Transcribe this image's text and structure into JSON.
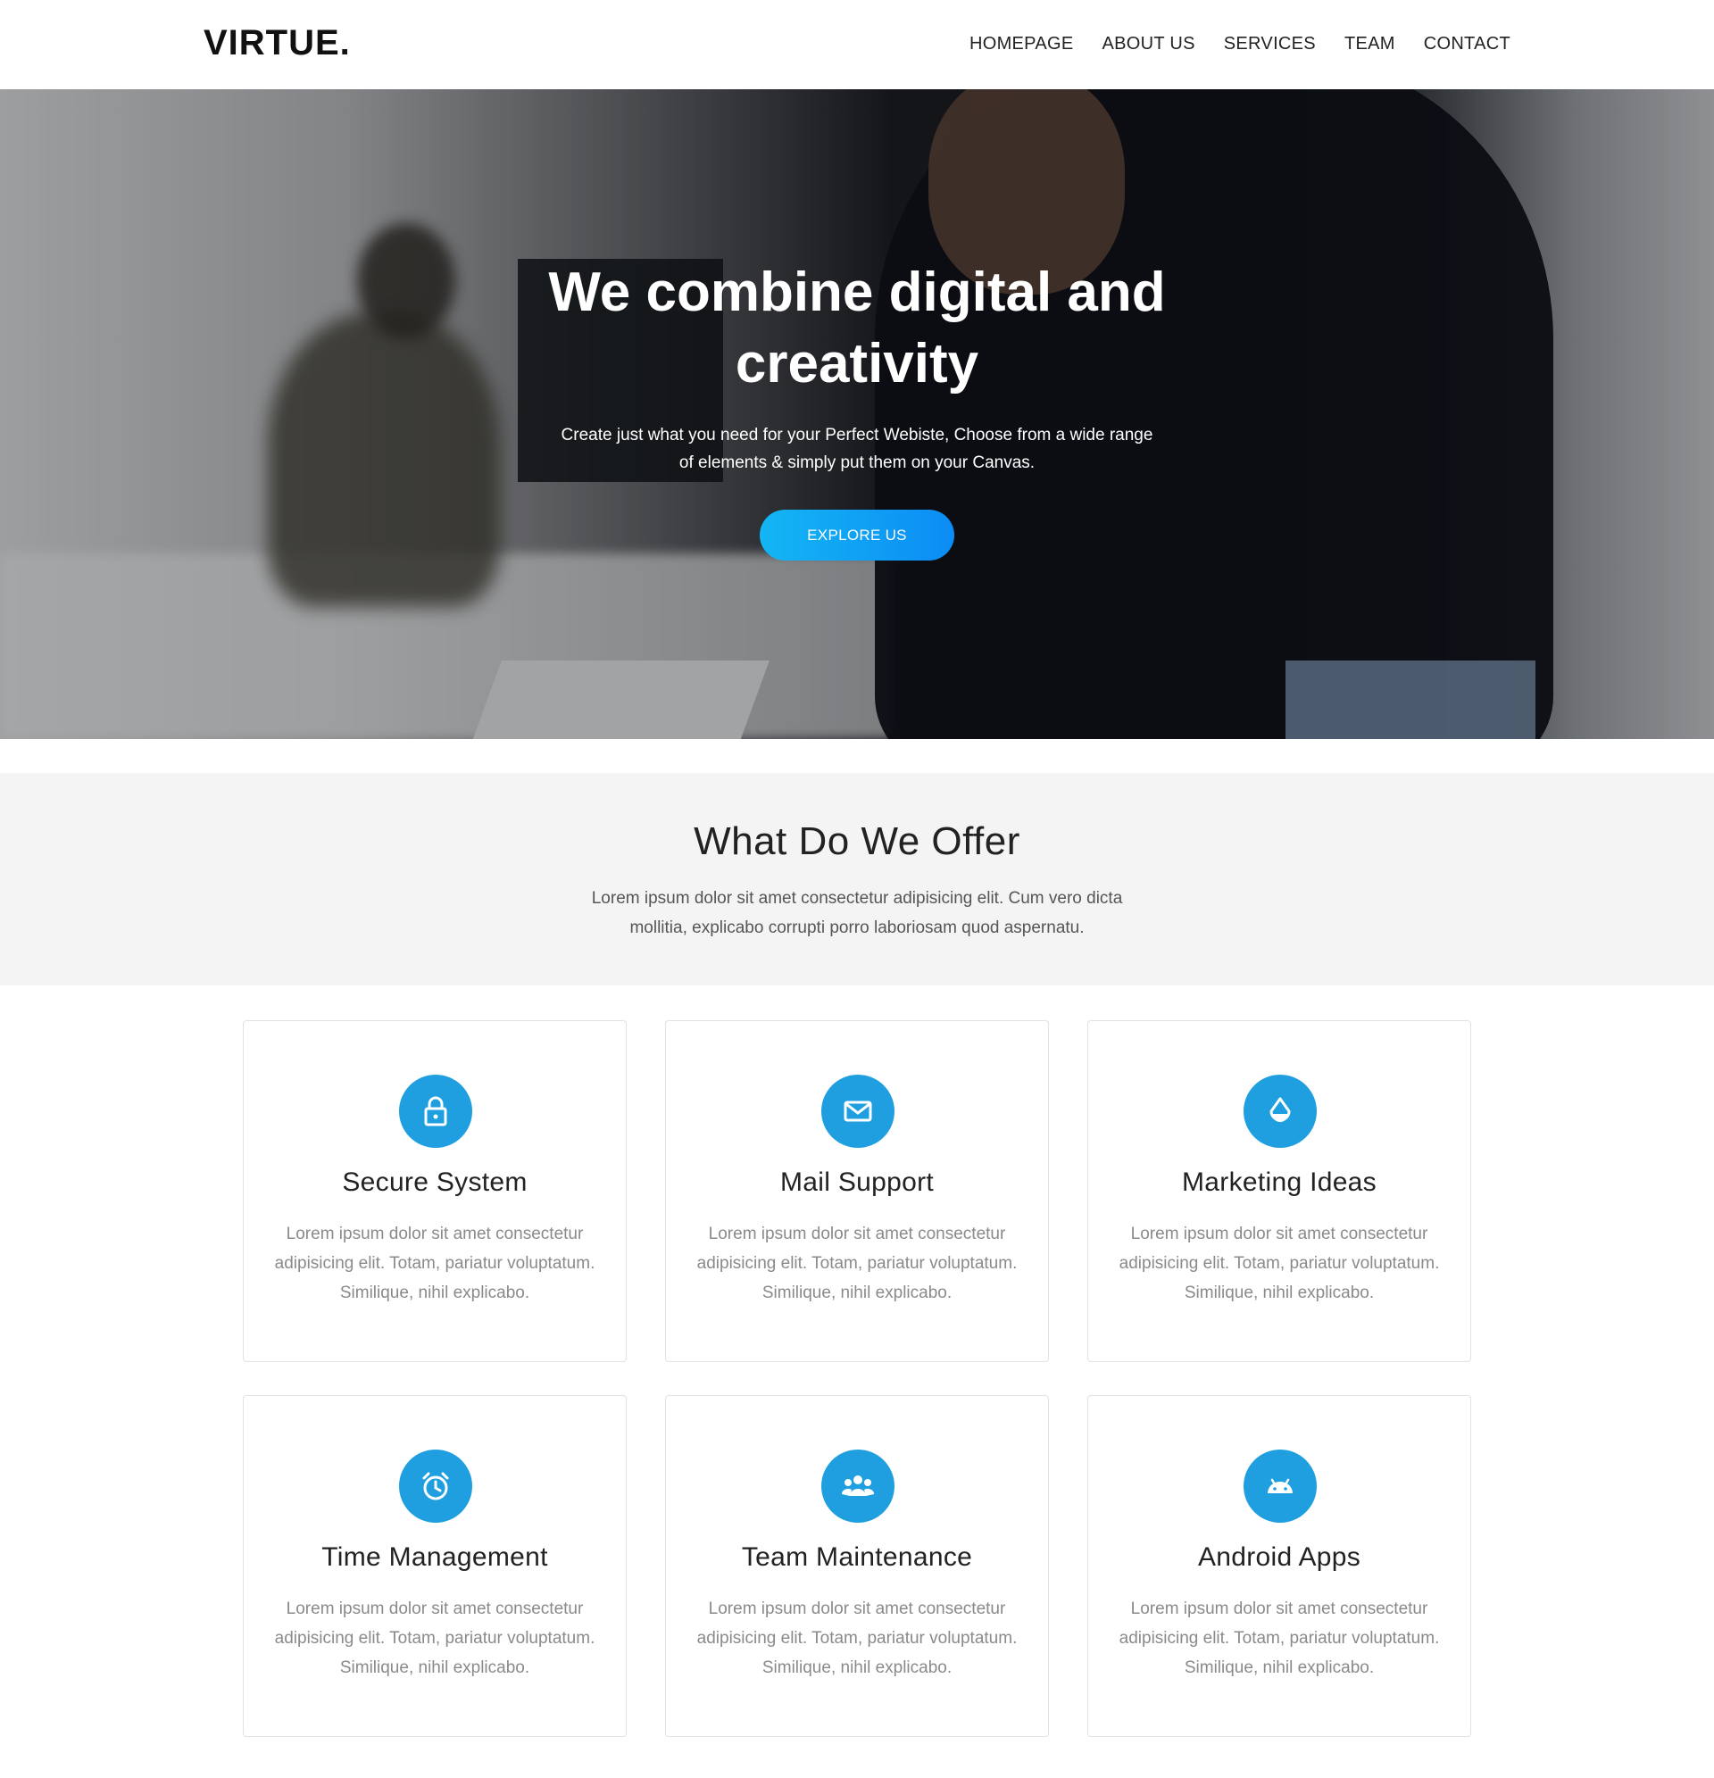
{
  "brand": {
    "logo": "VIRTUE.",
    "accent": "#1f9fe0"
  },
  "nav": {
    "items": [
      "HOMEPAGE",
      "ABOUT US",
      "SERVICES",
      "TEAM",
      "CONTACT"
    ]
  },
  "hero": {
    "title": "We combine digital and creativity",
    "subtitle": "Create just what you need for your Perfect Webiste, Choose from a wide range of elements & simply put them on your Canvas.",
    "button": "EXPLORE US"
  },
  "offer": {
    "title": "What Do We Offer",
    "description": "Lorem ipsum dolor sit amet consectetur adipisicing elit. Cum vero dicta mollitia, explicabo corrupti porro laboriosam quod aspernatu."
  },
  "cards": [
    {
      "icon": "lock-icon",
      "title": "Secure System",
      "text": "Lorem ipsum dolor sit amet consectetur adipisicing elit. Totam, pariatur voluptatum. Similique, nihil explicabo."
    },
    {
      "icon": "mail-icon",
      "title": "Mail Support",
      "text": "Lorem ipsum dolor sit amet consectetur adipisicing elit. Totam, pariatur voluptatum. Similique, nihil explicabo."
    },
    {
      "icon": "drop-icon",
      "title": "Marketing Ideas",
      "text": "Lorem ipsum dolor sit amet consectetur adipisicing elit. Totam, pariatur voluptatum. Similique, nihil explicabo."
    },
    {
      "icon": "alarm-clock-icon",
      "title": "Time Management",
      "text": "Lorem ipsum dolor sit amet consectetur adipisicing elit. Totam, pariatur voluptatum. Similique, nihil explicabo."
    },
    {
      "icon": "team-icon",
      "title": "Team Maintenance",
      "text": "Lorem ipsum dolor sit amet consectetur adipisicing elit. Totam, pariatur voluptatum. Similique, nihil explicabo."
    },
    {
      "icon": "android-icon",
      "title": "Android Apps",
      "text": "Lorem ipsum dolor sit amet consectetur adipisicing elit. Totam, pariatur voluptatum. Similique, nihil explicabo."
    }
  ]
}
